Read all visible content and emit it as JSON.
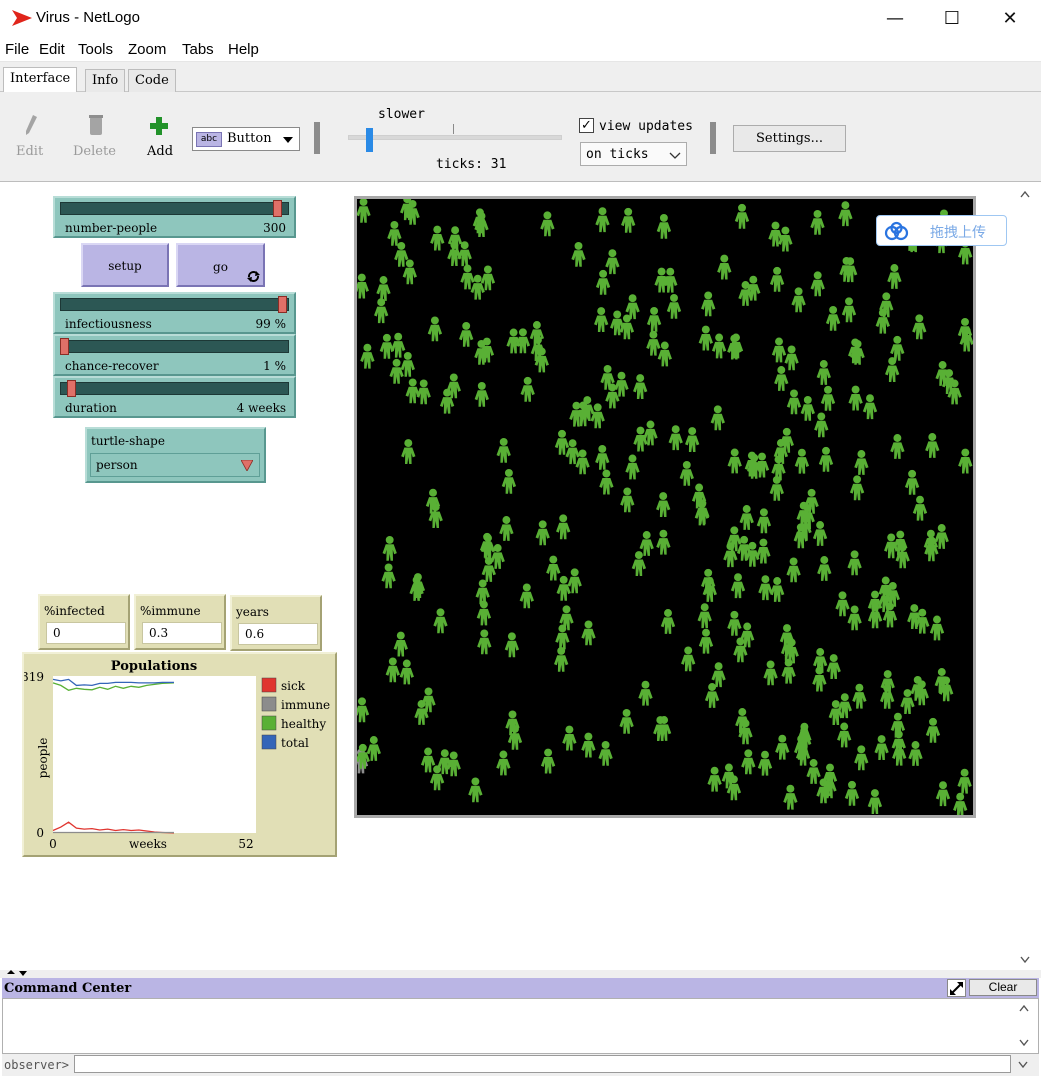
{
  "window": {
    "title": "Virus - NetLogo",
    "minimize": "—",
    "maximize": "☐",
    "close": "✕"
  },
  "menu": [
    "File",
    "Edit",
    "Tools",
    "Zoom",
    "Tabs",
    "Help"
  ],
  "tabs": [
    "Interface",
    "Info",
    "Code"
  ],
  "toolbar": {
    "edit_label": "Edit",
    "delete_label": "Delete",
    "add_label": "Add",
    "widget_type": "Button",
    "widget_type_icon": "abc",
    "speed_label": "slower",
    "speed_value": 0.1,
    "ticks_label": "ticks: 31",
    "view_updates_label": "view updates",
    "view_updates_checked": true,
    "update_mode": "on ticks",
    "settings_label": "Settings..."
  },
  "sliders": [
    {
      "name": "number-people",
      "value": "300",
      "fraction": 0.97
    },
    {
      "name": "infectiousness",
      "value": "99 %",
      "fraction": 0.99
    },
    {
      "name": "chance-recover",
      "value": "1 %",
      "fraction": 0.0
    },
    {
      "name": "duration",
      "value": "4 weeks",
      "fraction": 0.03
    }
  ],
  "buttons": {
    "setup": "setup",
    "go": "go"
  },
  "chooser": {
    "name": "turtle-shape",
    "value": "person"
  },
  "monitors": [
    {
      "label": "%infected",
      "value": "0"
    },
    {
      "label": "%immune",
      "value": "0.3"
    },
    {
      "label": "years",
      "value": "0.6"
    }
  ],
  "chart_data": {
    "type": "line",
    "title": "Populations",
    "xlabel": "weeks",
    "ylabel": "people",
    "xlim": [
      0,
      52
    ],
    "ylim": [
      0,
      319
    ],
    "x_ticks": [
      "0",
      "52"
    ],
    "y_ticks": [
      "0",
      "319"
    ],
    "legend_position": "right",
    "series": [
      {
        "name": "sick",
        "color": "#e0352f",
        "x": [
          0,
          2,
          4,
          6,
          8,
          10,
          12,
          14,
          16,
          18,
          20,
          22,
          24,
          26,
          28,
          31
        ],
        "y": [
          5,
          12,
          22,
          10,
          8,
          9,
          6,
          8,
          5,
          7,
          5,
          6,
          4,
          2,
          1,
          0
        ]
      },
      {
        "name": "immune",
        "color": "#8c8c8c",
        "x": [
          0,
          31
        ],
        "y": [
          1,
          1
        ]
      },
      {
        "name": "healthy",
        "color": "#59b035",
        "x": [
          0,
          2,
          4,
          6,
          8,
          10,
          12,
          14,
          16,
          18,
          20,
          22,
          24,
          26,
          28,
          31
        ],
        "y": [
          305,
          300,
          290,
          294,
          292,
          291,
          296,
          292,
          298,
          294,
          298,
          296,
          300,
          302,
          304,
          305
        ]
      },
      {
        "name": "total",
        "color": "#3465b8",
        "x": [
          0,
          2,
          4,
          6,
          8,
          10,
          12,
          14,
          16,
          18,
          20,
          22,
          24,
          26,
          28,
          31
        ],
        "y": [
          312,
          309,
          312,
          300,
          301,
          300,
          304,
          304,
          306,
          306,
          306,
          305,
          305,
          305,
          306,
          306
        ]
      }
    ]
  },
  "upload_badge": "拖拽上传",
  "command_center": {
    "title": "Command Center",
    "clear_label": "Clear",
    "prompt": "observer>",
    "input": ""
  }
}
